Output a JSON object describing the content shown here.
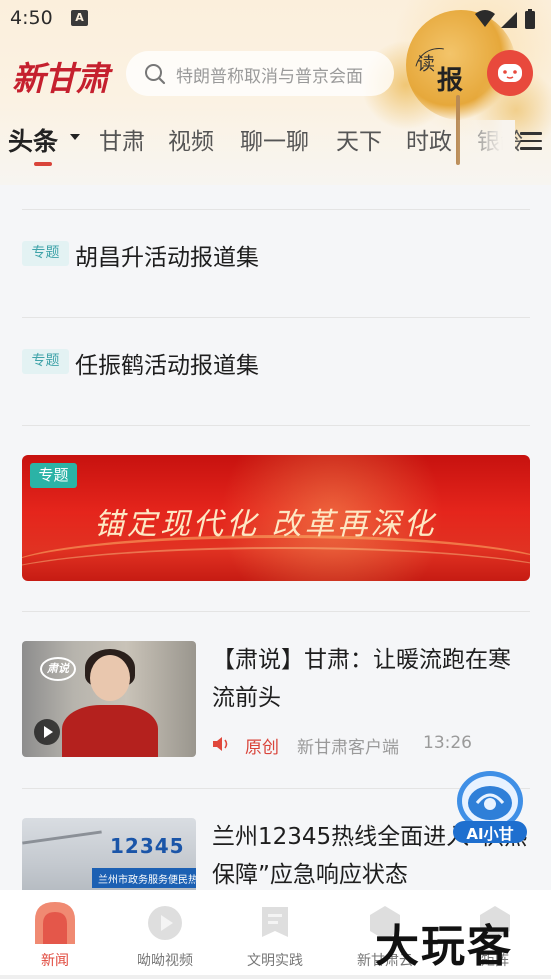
{
  "status_bar": {
    "time": "4:50",
    "notification_letter": "A"
  },
  "header": {
    "logo_text": "新甘肃",
    "search_placeholder": "特朗普称取消与普京会面",
    "read_paper": {
      "char1": "读",
      "char2": "报"
    }
  },
  "tabs": [
    {
      "label": "头条",
      "active": true
    },
    {
      "label": "甘肃"
    },
    {
      "label": "视频"
    },
    {
      "label": "聊一聊"
    },
    {
      "label": "天下"
    },
    {
      "label": "时政"
    },
    {
      "label": "银龄"
    }
  ],
  "feed": {
    "topics": [
      {
        "tag": "专题",
        "title": "胡昌升活动报道集"
      },
      {
        "tag": "专题",
        "title": "任振鹤活动报道集"
      }
    ],
    "banner": {
      "tag": "专题",
      "text": "锚定现代化 改革再深化"
    },
    "articles": [
      {
        "title": "【肃说】甘肃：让暖流跑在寒流前头",
        "thumb_logo": "肃说",
        "original_label": "原创",
        "source": "新甘肃客户端",
        "time": "13:26"
      },
      {
        "title": "兰州12345热线全面进入“供热保障”应急响应状态",
        "thumb_number": "12345",
        "thumb_sign": "兰州市政务服务便民热线"
      }
    ]
  },
  "ai_assistant": {
    "label": "AI小甘"
  },
  "bottom_nav": [
    {
      "label": "新闻",
      "icon": "news-icon",
      "active": true
    },
    {
      "label": "呦呦视频",
      "icon": "video-icon"
    },
    {
      "label": "文明实践",
      "icon": "civilization-icon"
    },
    {
      "label": "新甘肃云",
      "icon": "cloud-icon"
    },
    {
      "label": "矩阵",
      "icon": "matrix-icon"
    }
  ],
  "watermark": "大玩客",
  "colors": {
    "brand_red": "#c5202e",
    "accent_red": "#d9443a",
    "topic_teal": "#3fa3a9"
  }
}
